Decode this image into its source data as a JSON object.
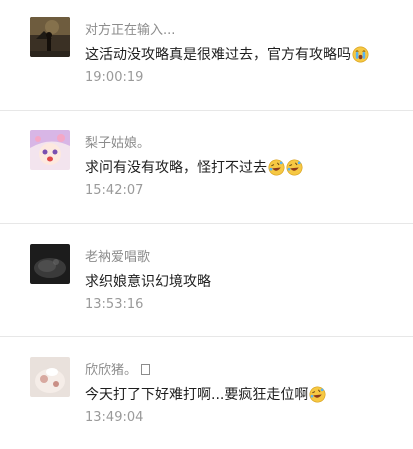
{
  "comments": [
    {
      "name": "对方正在输入...",
      "text": "这活动没攻略真是很难过去，官方有攻略吗",
      "emojis": [
        "crying-face-icon"
      ],
      "time": "19:00:19"
    },
    {
      "name": "梨子姑娘。",
      "text": "求问有没有攻略，怪打不过去",
      "emojis": [
        "laughing-crying-face-icon",
        "laughing-crying-face-icon"
      ],
      "time": "15:42:07"
    },
    {
      "name": "老衲爱唱歌",
      "text": "求织娘意识幻境攻略",
      "emojis": [],
      "time": "13:53:16"
    },
    {
      "name": "欣欣猪。",
      "name_icon": "unknown-glyph-icon",
      "text": "今天打了下好难打啊...要疯狂走位啊",
      "emojis": [
        "laughing-crying-face-icon"
      ],
      "time": "13:49:04"
    }
  ]
}
